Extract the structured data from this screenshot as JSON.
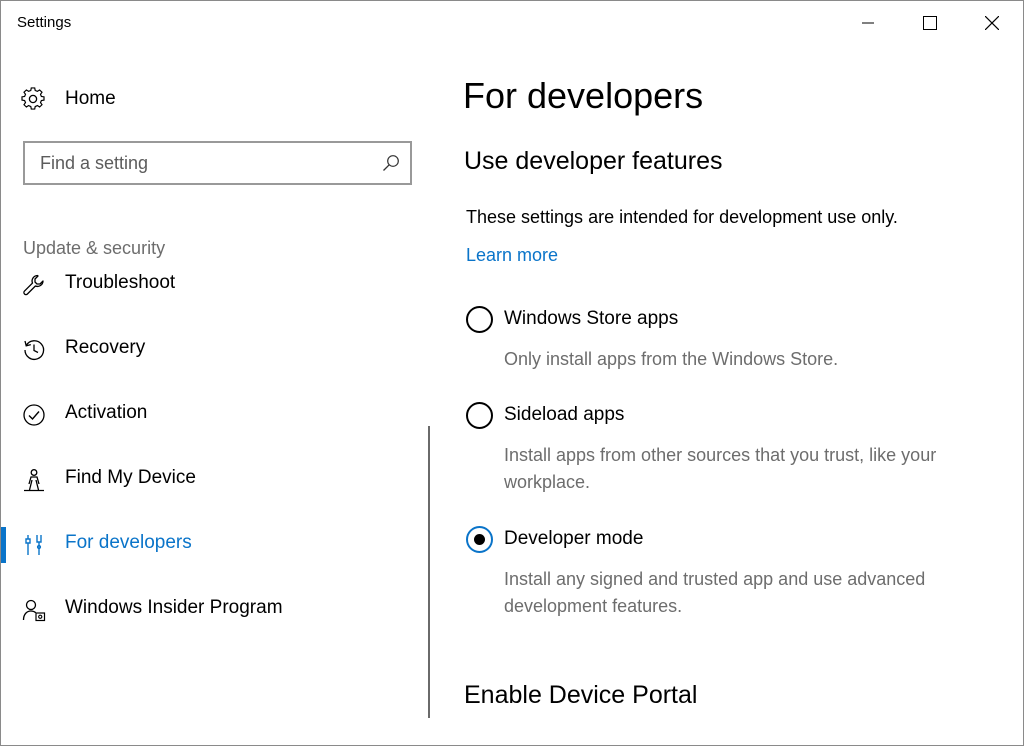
{
  "window": {
    "title": "Settings"
  },
  "sidebar": {
    "home_label": "Home",
    "search_placeholder": "Find a setting",
    "section_label": "Update & security",
    "items": [
      {
        "label": "Troubleshoot",
        "icon": "wrench-icon"
      },
      {
        "label": "Recovery",
        "icon": "history-icon"
      },
      {
        "label": "Activation",
        "icon": "check-circle-icon"
      },
      {
        "label": "Find My Device",
        "icon": "person-location-icon"
      },
      {
        "label": "For developers",
        "icon": "developer-tools-icon",
        "active": true
      },
      {
        "label": "Windows Insider Program",
        "icon": "insider-icon"
      }
    ]
  },
  "main": {
    "page_title": "For developers",
    "section_title": "Use developer features",
    "description": "These settings are intended for development use only.",
    "learn_more": "Learn more",
    "options": [
      {
        "label": "Windows Store apps",
        "description": "Only install apps from the Windows Store.",
        "checked": false
      },
      {
        "label": "Sideload apps",
        "description": "Install apps from other sources that you trust, like your workplace.",
        "checked": false
      },
      {
        "label": "Developer mode",
        "description": "Install any signed and trusted app and use advanced development features.",
        "checked": true
      }
    ],
    "portal_title": "Enable Device Portal"
  },
  "colors": {
    "accent": "#0a74c9",
    "secondary_text": "#6d6d6d"
  }
}
